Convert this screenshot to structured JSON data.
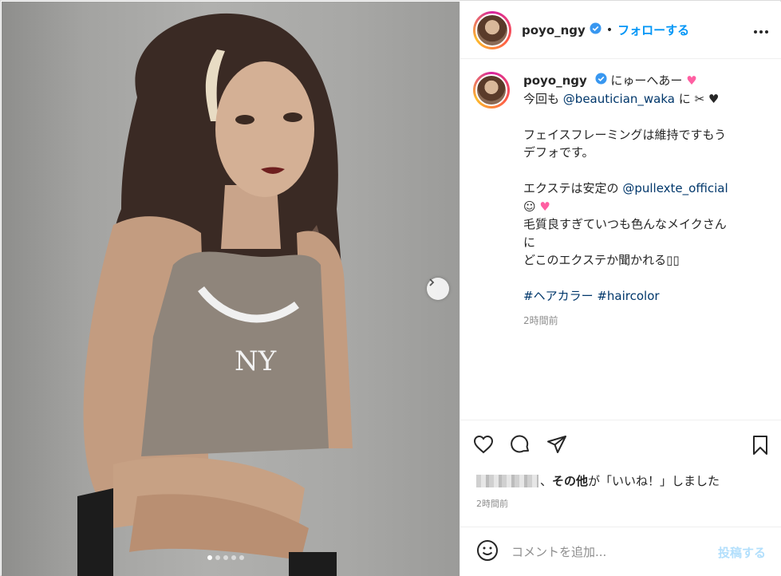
{
  "header": {
    "username": "poyo_ngy",
    "separator": "•",
    "follow_label": "フォローする"
  },
  "caption": {
    "username": "poyo_ngy",
    "line1": "にゅーへあー",
    "line2_prefix": "今回も",
    "mention1": "@beautician_waka",
    "line2_suffix": "に",
    "line3": "フェイスフレーミングは維持ですもう",
    "line4": "デフォです。",
    "line5_prefix": "エクステは安定の",
    "mention2": "@pullexte_official",
    "line6": "毛質良すぎていつも色んなメイクさん",
    "line7": "に",
    "line8": "どこのエクステか聞かれる",
    "hashtag1": "#ヘアカラー",
    "hashtag2": "#haircolor",
    "time": "2時間前"
  },
  "likes": {
    "text_bold": "その他",
    "text_rest": "が「いいね！」しました",
    "comma": "、"
  },
  "post_date": "2時間前",
  "comment": {
    "placeholder": "コメントを追加...",
    "post_label": "投稿する"
  },
  "carousel": {
    "total": 5,
    "active_index": 0
  },
  "colors": {
    "follow_blue": "#0095f6",
    "link_dark": "#00376b",
    "post_disabled": "#b2dffc",
    "heart_pink": "#ff5fa2"
  }
}
